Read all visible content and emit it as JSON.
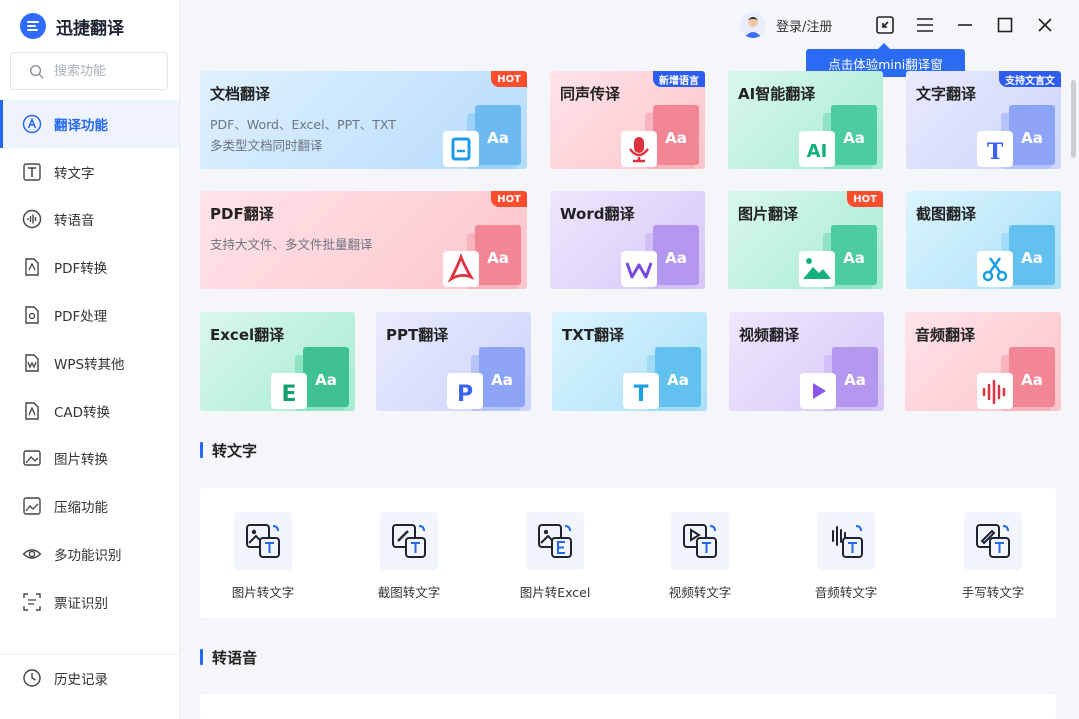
{
  "app": {
    "title": "迅捷翻译"
  },
  "search": {
    "placeholder": "搜索功能"
  },
  "sidebar": {
    "items": [
      {
        "label": "翻译功能",
        "icon": "translate-icon",
        "active": true
      },
      {
        "label": "转文字",
        "icon": "text-icon"
      },
      {
        "label": "转语音",
        "icon": "voice-icon"
      },
      {
        "label": "PDF转换",
        "icon": "pdf-convert-icon"
      },
      {
        "label": "PDF处理",
        "icon": "pdf-process-icon"
      },
      {
        "label": "WPS转其他",
        "icon": "wps-icon"
      },
      {
        "label": "CAD转换",
        "icon": "cad-icon"
      },
      {
        "label": "图片转换",
        "icon": "image-convert-icon"
      },
      {
        "label": "压缩功能",
        "icon": "compress-icon"
      },
      {
        "label": "多功能识别",
        "icon": "eye-icon"
      },
      {
        "label": "票证识别",
        "icon": "ticket-icon"
      }
    ],
    "bottom": {
      "label": "历史记录",
      "icon": "history-icon"
    }
  },
  "topbar": {
    "login_label": "登录/注册",
    "tooltip": "点击体验mini翻译窗"
  },
  "cards": {
    "doc": {
      "title": "文档翻译",
      "desc1": "PDF、Word、Excel、PPT、TXT",
      "desc2": "多类型文档同时翻译",
      "badge": "HOT"
    },
    "simul": {
      "title": "同声传译",
      "badge": "新增语言"
    },
    "ai": {
      "title": "AI智能翻译",
      "glyph": "AI"
    },
    "text": {
      "title": "文字翻译",
      "badge": "支持文言文",
      "glyph": "T"
    },
    "pdf": {
      "title": "PDF翻译",
      "desc1": "支持大文件、多文件批量翻译",
      "badge": "HOT"
    },
    "word": {
      "title": "Word翻译"
    },
    "image": {
      "title": "图片翻译",
      "badge": "HOT"
    },
    "shot": {
      "title": "截图翻译"
    },
    "excel": {
      "title": "Excel翻译",
      "glyph": "E"
    },
    "ppt": {
      "title": "PPT翻译",
      "glyph": "P"
    },
    "txt": {
      "title": "TXT翻译",
      "glyph": "T"
    },
    "video": {
      "title": "视频翻译"
    },
    "audio": {
      "title": "音频翻译"
    },
    "aa": "Aa"
  },
  "sections": {
    "to_text": {
      "title": "转文字",
      "tools": [
        {
          "label": "图片转文字",
          "icon": "image-to-text-icon"
        },
        {
          "label": "截图转文字",
          "icon": "screenshot-to-text-icon"
        },
        {
          "label": "图片转Excel",
          "icon": "image-to-excel-icon"
        },
        {
          "label": "视频转文字",
          "icon": "video-to-text-icon"
        },
        {
          "label": "音频转文字",
          "icon": "audio-to-text-icon"
        },
        {
          "label": "手写转文字",
          "icon": "handwriting-to-text-icon"
        }
      ]
    },
    "to_voice": {
      "title": "转语音"
    }
  },
  "colors": {
    "accent": "#2468f2",
    "hot": "#ff4d2d",
    "badge_blue": "#2f5cf0"
  }
}
